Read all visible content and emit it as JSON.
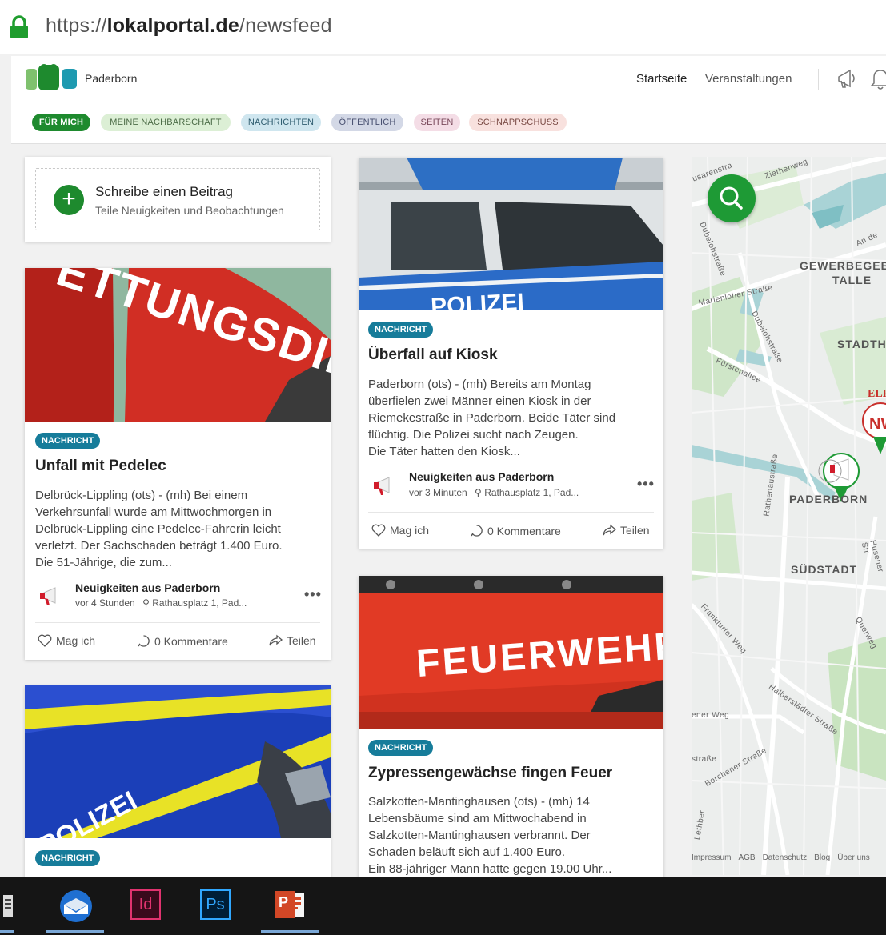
{
  "browser": {
    "url_scheme": "https://",
    "url_domain": "lokalportal.de",
    "url_path": "/newsfeed"
  },
  "header": {
    "city": "Paderborn",
    "nav": {
      "start": "Startseite",
      "events": "Veranstaltungen"
    }
  },
  "filters": [
    "FÜR MICH",
    "MEINE NACHBARSCHAFT",
    "NACHRICHTEN",
    "ÖFFENTLICH",
    "SEITEN",
    "SCHNAPPSCHUSS"
  ],
  "compose": {
    "title": "Schreibe einen Beitrag",
    "subtitle": "Teile Neuigkeiten und Beobachtungen"
  },
  "posts": [
    {
      "badge": "NACHRICHT",
      "title": "Unfall mit Pedelec",
      "image_text": "ETTUNGSDIENST",
      "lines": [
        "Delbrück-Lippling (ots) - (mh) Bei einem",
        "Verkehrsunfall wurde am Mittwochmorgen in",
        "Delbrück-Lippling eine Pedelec-Fahrerin leicht",
        "verletzt. Der Sachschaden beträgt 1.400 Euro.",
        "Die 51-Jährige, die zum..."
      ],
      "source": "Neuigkeiten aus Paderborn",
      "time": "vor 4 Stunden",
      "location": "Rathausplatz 1, Pad...",
      "like": "Mag ich",
      "comments": "0 Kommentare",
      "share": "Teilen"
    },
    {
      "badge": "NACHRICHT",
      "title": "Überfall auf Kiosk",
      "image_text": "POLIZEI",
      "lines": [
        "Paderborn (ots) - (mh) Bereits am Montag",
        "überfielen zwei Männer einen Kiosk in der",
        "Riemekestraße in Paderborn. Beide Täter sind",
        "flüchtig. Die Polizei sucht nach Zeugen.",
        "Die Täter hatten den Kiosk..."
      ],
      "source": "Neuigkeiten aus Paderborn",
      "time": "vor 3 Minuten",
      "location": "Rathausplatz 1, Pad...",
      "like": "Mag ich",
      "comments": "0 Kommentare",
      "share": "Teilen"
    },
    {
      "badge": "NACHRICHT",
      "title": "Zypressengewächse fingen Feuer",
      "image_text": "FEUERWEHR",
      "lines": [
        "Salzkotten-Mantinghausen (ots) - (mh) 14",
        "Lebensbäume sind am Mittwochabend in",
        "Salzkotten-Mantinghausen verbrannt. Der",
        "Schaden beläuft sich auf 1.400 Euro.",
        "Ein 88-jähriger Mann hatte gegen 19.00 Uhr..."
      ]
    },
    {
      "badge": "NACHRICHT",
      "image_text": "POLIZEI"
    }
  ],
  "map": {
    "labels": {
      "gewerbe1": "GEWERBEGEBI",
      "gewerbe2": "TALLE",
      "stadth": "STADTH",
      "paderborn": "PADERBORN",
      "suedstadt": "SÜDSTADT",
      "ziethenweg": "Ziethenweg",
      "marienloher": "Marienloher Straße",
      "dubeloh1": "Dubelohstraße",
      "dubeloh2": "Dubelohstraße",
      "fuerstenallee": "Fürstenallee",
      "rathenau": "Rathenaustraße",
      "husener": "Husener Str",
      "frankfurter": "Frankfurter Weg",
      "halberstaedter": "Halberstädter Straße",
      "querweg": "Querweg",
      "ener_weg": "ener Weg",
      "strasse": "straße",
      "borchener": "Borchener Straße",
      "and": "An de",
      "nw": "NW",
      "elp": "ELP",
      "usarenstr": "usarenstra",
      "lethber": "Lethber"
    },
    "footer": [
      "Impressum",
      "AGB",
      "Datenschutz",
      "Blog",
      "Über uns"
    ]
  },
  "taskbar": {
    "indesign": "Id",
    "photoshop": "Ps",
    "powerpoint": "P"
  },
  "colors": {
    "brand_green": "#1e8a2e",
    "badge_blue": "#167c9a",
    "map_water": "#a9d3d6",
    "taskbar": "#151515"
  }
}
